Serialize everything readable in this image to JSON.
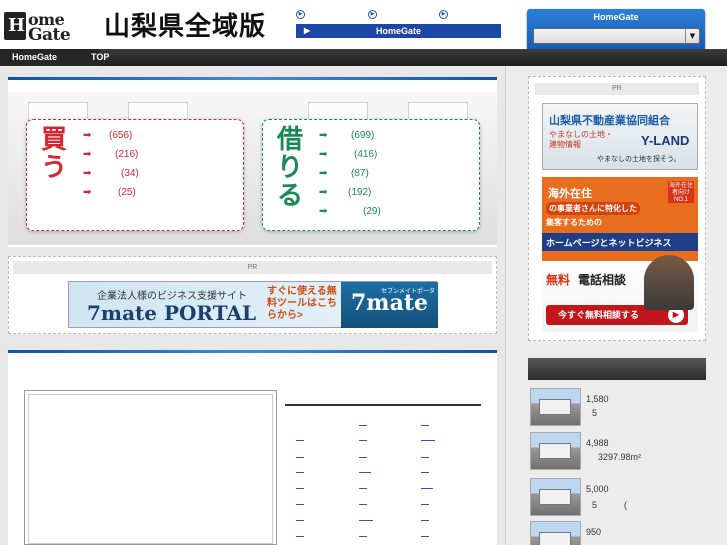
{
  "header": {
    "logo_line1": "ome",
    "logo_line2": "Gate",
    "logo_initial": "H",
    "site_title": "山梨県全域版",
    "bluebar_label": "HomeGate",
    "right_box_label": "HomeGate",
    "right_box_select_value": ""
  },
  "nav": {
    "items": [
      "HomeGate",
      "TOP"
    ]
  },
  "buy": {
    "label_chars": [
      "買",
      "う"
    ],
    "counts": [
      "(656)",
      "(216)",
      "(34)",
      "(25)"
    ]
  },
  "rent": {
    "label_chars": [
      "借",
      "り",
      "る"
    ],
    "counts": [
      "(699)",
      "(416)",
      "(87)",
      "(192)",
      "(29)"
    ]
  },
  "pr": {
    "label": "PR",
    "banner": {
      "tagline": "企業法人様のビジネス支援サイト",
      "name": "7mate PORTAL",
      "promo": "すぐに使える無料ツールはこちらから>",
      "logo": "7mate",
      "logo_small": "セブンメイトポータル"
    }
  },
  "right_pr": {
    "label": "PR",
    "ad1": {
      "title": "山梨県不動産業協同組合",
      "sub": "やまなしの土地・建物情報",
      "brand": "Y-LAND",
      "tag": "やまなしの土地を探そう。"
    },
    "ad2": {
      "title": "海外在住",
      "line1": "の事業者さんに特化した",
      "line2": "集客するための",
      "line3": "ホームページとネットビジネス",
      "badge": "海外在住者向け NO.1",
      "free": "無料",
      "free2": "電話相談",
      "button": "今すぐ無料相談する"
    }
  },
  "listings": [
    {
      "price": "1,580",
      "detail": "5"
    },
    {
      "price": "4,988",
      "detail": "3297.98m²"
    },
    {
      "price": "5,000",
      "detail": "5　　　("
    },
    {
      "price": "950",
      "detail": ""
    }
  ],
  "colors": {
    "buy_accent": "#d9262e",
    "rent_accent": "#1a8a55",
    "brand_blue": "#1c47a6"
  }
}
